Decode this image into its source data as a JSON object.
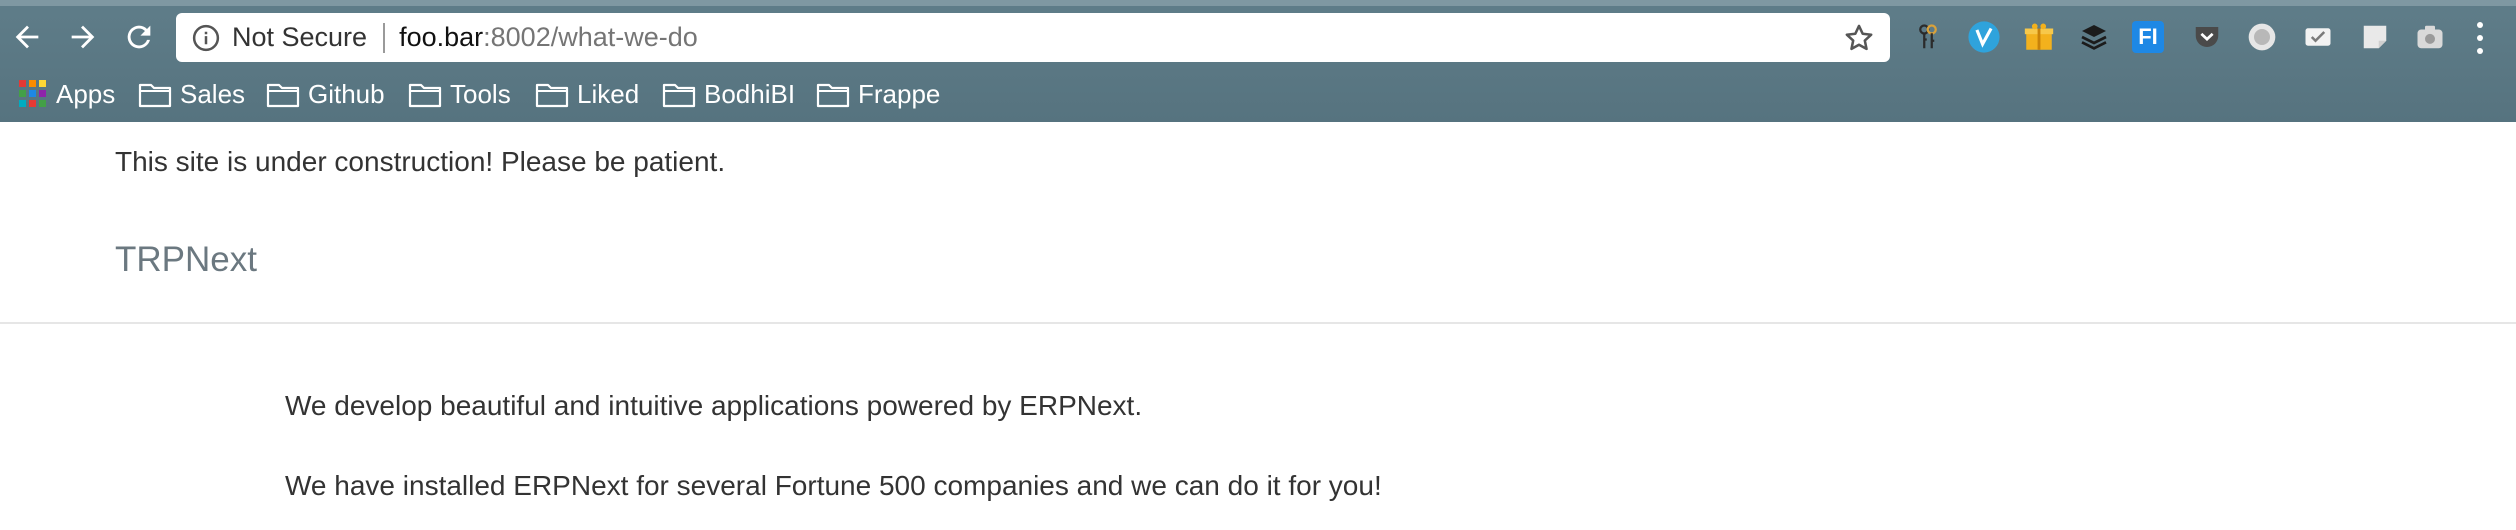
{
  "browser": {
    "security_label": "Not Secure",
    "url_host": "foo.bar",
    "url_rest": ":8002/what-we-do",
    "icons": {
      "back": "back-arrow-icon",
      "forward": "forward-arrow-icon",
      "reload": "reload-icon",
      "info": "info-icon",
      "bookmark_star": "star-icon",
      "menu": "more-vert-icon"
    },
    "extensions": [
      "key-extension-icon",
      "vimium-extension-icon",
      "gift-extension-icon",
      "buffer-extension-icon",
      "fi-extension-icon",
      "pocket-extension-icon",
      "circle-extension-icon",
      "inbox-extension-icon",
      "note-extension-icon",
      "camera-extension-icon"
    ],
    "extension_text": {
      "fi": "FI"
    }
  },
  "bookmarks": {
    "apps_label": "Apps",
    "folders": [
      "Sales",
      "Github",
      "Tools",
      "Liked",
      "BodhiBI",
      "Frappe"
    ]
  },
  "page": {
    "notice": "This site is under construction! Please be patient.",
    "brand": "TRPNext",
    "paragraphs": [
      "We develop beautiful and intuitive applications powered by ERPNext.",
      "We have installed ERPNext for several Fortune 500 companies and we can do it for you!"
    ]
  },
  "colors": {
    "chrome": "#5a7783",
    "brand_text": "#6b7880",
    "body_text": "#333333"
  }
}
